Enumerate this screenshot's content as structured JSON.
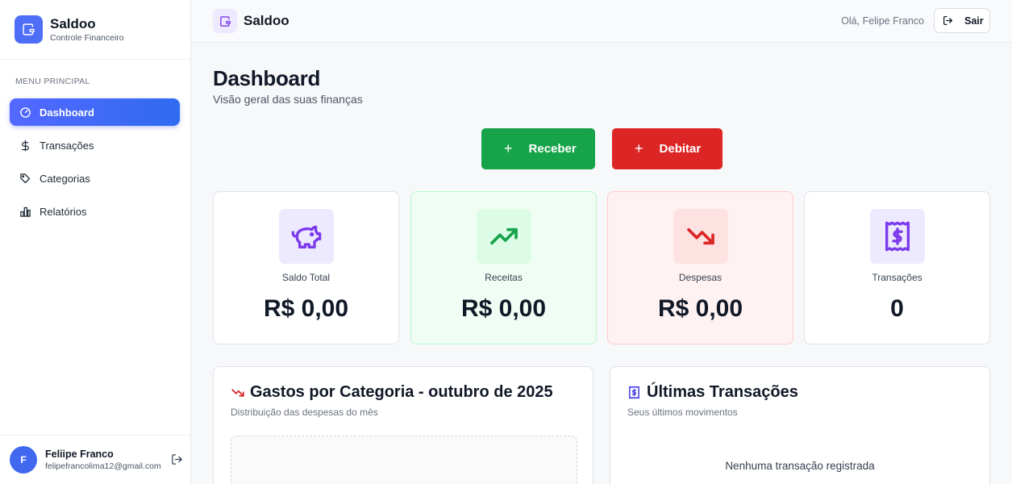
{
  "sidebar": {
    "brand_name": "Saldoo",
    "brand_subtitle": "Controle Financeiro",
    "menu_label": "MENU PRINCIPAL",
    "items": [
      {
        "label": "Dashboard",
        "icon": "gauge-icon"
      },
      {
        "label": "Transações",
        "icon": "dollar-icon"
      },
      {
        "label": "Categorias",
        "icon": "tags-icon"
      },
      {
        "label": "Relatórios",
        "icon": "bar-chart-icon"
      }
    ],
    "user": {
      "initial": "F",
      "name": "Feliipe Franco",
      "email": "felipefrancolima12@gmail.com"
    }
  },
  "topbar": {
    "title": "Saldoo",
    "greeting": "Olá, Felipe Franco",
    "logout_label": "Sair"
  },
  "main": {
    "title": "Dashboard",
    "subtitle": "Visão geral das suas finanças",
    "actions": {
      "receive_label": "Receber",
      "debit_label": "Debitar",
      "plus": "+"
    },
    "stats": [
      {
        "label": "Saldo Total",
        "value": "R$ 0,00",
        "icon": "piggy-bank-icon"
      },
      {
        "label": "Receitas",
        "value": "R$ 0,00",
        "icon": "trending-up-icon"
      },
      {
        "label": "Despesas",
        "value": "R$ 0,00",
        "icon": "trending-down-icon"
      },
      {
        "label": "Transações",
        "value": "0",
        "icon": "receipt-icon"
      }
    ],
    "expenses_panel": {
      "title": "Gastos por Categoria - outubro de 2025",
      "subtitle": "Distribuição das despesas do mês"
    },
    "transactions_panel": {
      "title": "Últimas Transações",
      "subtitle": "Seus últimos movimentos",
      "empty_text": "Nenhuma transação registrada"
    }
  },
  "colors": {
    "primary": "#4f6ef7",
    "receive": "#16a34a",
    "debit": "#dc2626",
    "income_bg": "#f0fdf4",
    "expense_bg": "#fef2f2",
    "purple_icon": "#7c3aed"
  }
}
